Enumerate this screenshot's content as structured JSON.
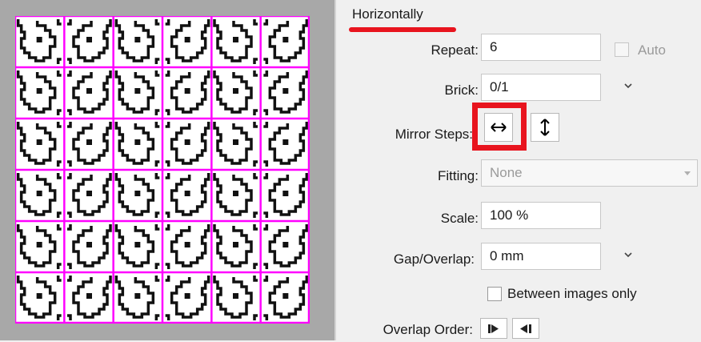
{
  "section": {
    "title": "Horizontally"
  },
  "repeat": {
    "label": "Repeat:",
    "value": "6",
    "auto_label": "Auto"
  },
  "brick": {
    "label": "Brick:",
    "value": "0/1"
  },
  "mirror": {
    "label": "Mirror Steps:"
  },
  "fitting": {
    "label": "Fitting:",
    "value": "None"
  },
  "scale": {
    "label": "Scale:",
    "value": "100 %"
  },
  "gap": {
    "label": "Gap/Overlap:",
    "value": "0 mm"
  },
  "between": {
    "label": "Between images only"
  },
  "overlap": {
    "label": "Overlap Order:"
  },
  "preview": {
    "columns": 6,
    "rows": 6,
    "grid_color": "#ff00ff"
  },
  "colors": {
    "accent_red": "#e8141e"
  },
  "icons": {
    "mirror_h": "horizontal-double-arrow-icon",
    "mirror_v": "vertical-double-arrow-icon",
    "order_forward": "play-forward-icon",
    "order_back": "play-back-icon"
  }
}
